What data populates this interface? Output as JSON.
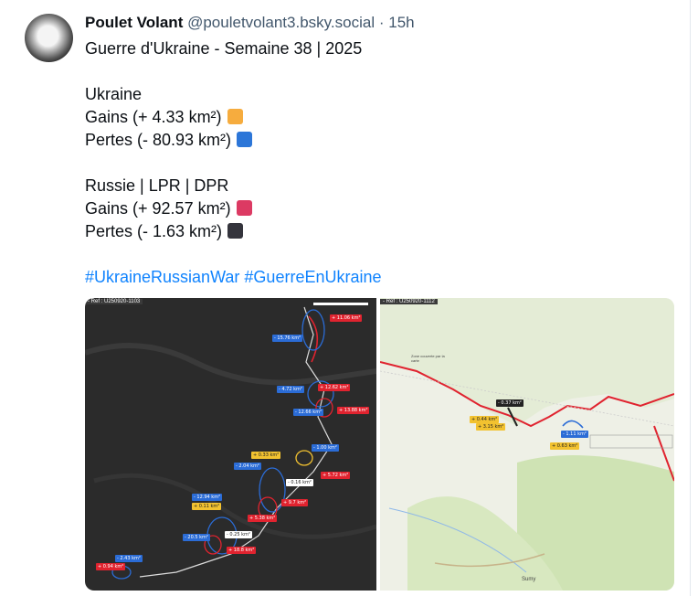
{
  "post": {
    "author_name": "Poulet Volant",
    "handle": "@pouletvolant3.bsky.social",
    "separator": "·",
    "time": "15h",
    "title": "Guerre d'Ukraine - Semaine 38 | 2025",
    "ukraine": {
      "heading": "Ukraine",
      "gains": "Gains (+ 4.33 km²)",
      "losses": "Pertes (- 80.93 km²)"
    },
    "russia": {
      "heading": "Russie | LPR | DPR",
      "gains": "Gains (+ 92.57 km²)",
      "losses": "Pertes (- 1.63 km²)"
    },
    "hashtags": [
      "#UkraineRussianWar",
      "#GuerreEnUkraine"
    ]
  },
  "colors": {
    "ukraine_gains": "#f6ac3e",
    "ukraine_losses": "#2c76d8",
    "russia_gains": "#dc3a63",
    "russia_losses": "#34343c",
    "link": "#1083fe"
  },
  "images": {
    "map1": {
      "ref": "- Ref : U250920-1103",
      "labels": [
        {
          "text": "- 15.76 km²",
          "c": "blue"
        },
        {
          "text": "+ 11.06 km²",
          "c": "red"
        },
        {
          "text": "- 4.72 km²",
          "c": "blue"
        },
        {
          "text": "+ 12.62 km²",
          "c": "red"
        },
        {
          "text": "- 12.66 km²",
          "c": "blue"
        },
        {
          "text": "+ 13.88 km²",
          "c": "red"
        },
        {
          "text": "- 1.00 km²",
          "c": "blue"
        },
        {
          "text": "+ 0.33 km²",
          "c": "yellow"
        },
        {
          "text": "- 2.04 km²",
          "c": "blue"
        },
        {
          "text": "- 0.16 km²",
          "c": "white"
        },
        {
          "text": "+ 5.72 km²",
          "c": "red"
        },
        {
          "text": "- 12.94 km²",
          "c": "blue"
        },
        {
          "text": "+ 0.11 km²",
          "c": "yellow"
        },
        {
          "text": "+ 9.7 km²",
          "c": "red"
        },
        {
          "text": "+ 5.38 km²",
          "c": "red"
        },
        {
          "text": "- 20.5 km²",
          "c": "blue"
        },
        {
          "text": "- 0.25 km²",
          "c": "white"
        },
        {
          "text": "+ 18.8 km²",
          "c": "red"
        },
        {
          "text": "- 2.43 km²",
          "c": "blue"
        },
        {
          "text": "+ 0.94 km²",
          "c": "red"
        }
      ]
    },
    "map2": {
      "ref": "- Ref : U250920-1112",
      "area_label": "Zone couverte par la carte",
      "labels": [
        {
          "text": "- 0.37 km²",
          "c": "dark"
        },
        {
          "text": "+ 0.44 km²",
          "c": "yellow"
        },
        {
          "text": "+ 3.15 km²",
          "c": "yellow"
        },
        {
          "text": "- 1.11 km²",
          "c": "blue"
        },
        {
          "text": "+ 0.63 km²",
          "c": "yellow"
        }
      ],
      "city": "Sumy"
    }
  }
}
